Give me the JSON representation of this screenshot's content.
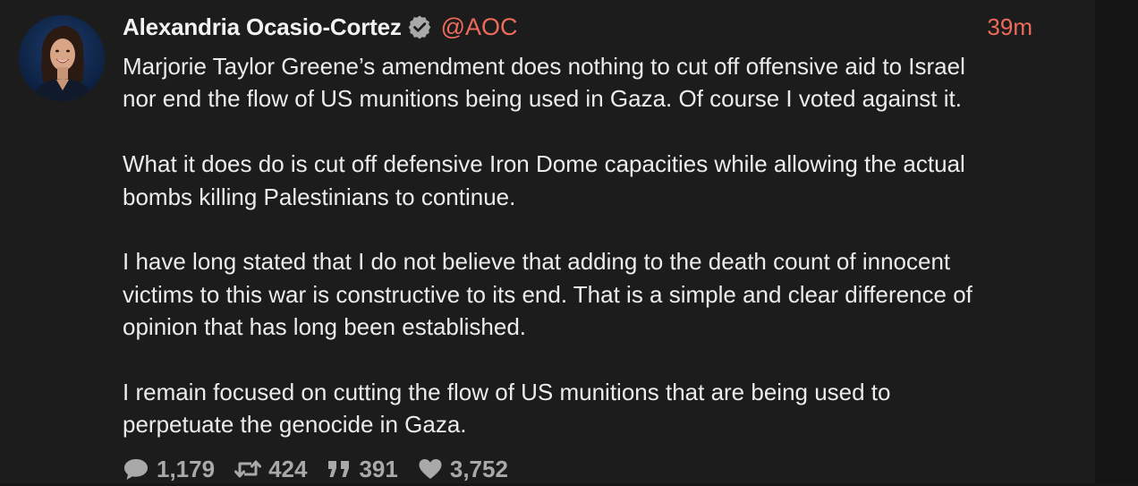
{
  "post": {
    "display_name": "Alexandria Ocasio-Cortez",
    "handle": "@AOC",
    "time": "39m",
    "paragraphs": [
      "Marjorie Taylor Greene’s amendment does nothing to cut off offensive aid to Israel\nnor end the flow of US munitions being used in Gaza. Of course I voted against it.",
      "What it does do is cut off defensive Iron Dome capacities while allowing the actual\nbombs killing Palestinians to continue.",
      "I have long stated that I do not believe that adding to the death count of innocent\nvictims to this war is constructive to its end. That is a simple and clear difference of\nopinion that has long been established.",
      "I remain focused on cutting the flow of US munitions that are being used to\nperpetuate the genocide in Gaza."
    ]
  },
  "stats": {
    "replies": "1,179",
    "reposts": "424",
    "quotes": "391",
    "likes": "3,752"
  },
  "icons": {
    "verified": "verified-check-icon",
    "reply": "speech-bubble-icon",
    "repost": "repost-arrows-icon",
    "quote": "quote-marks-icon",
    "like": "heart-icon"
  },
  "colors": {
    "background": "#1c1c1c",
    "accent": "#ee6a5a",
    "text": "#ececec",
    "muted": "#a9a9a9"
  }
}
